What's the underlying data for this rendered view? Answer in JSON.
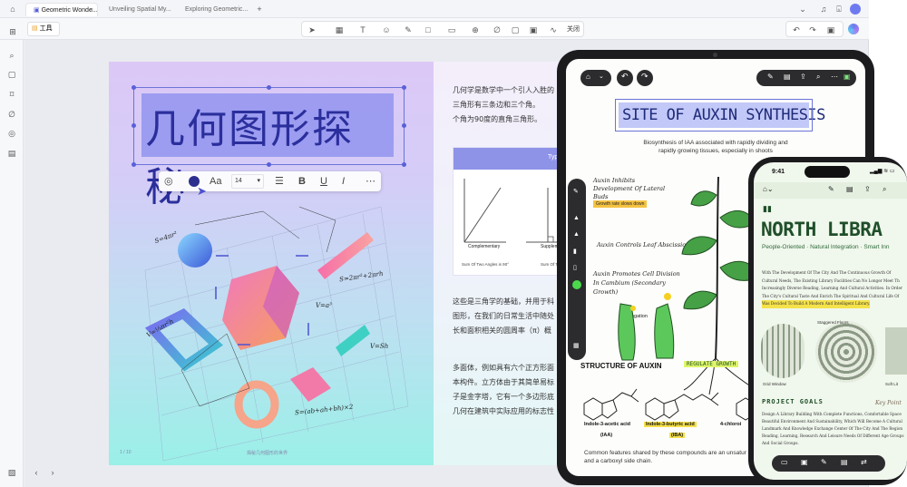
{
  "tabs": [
    "Geometric Wonde...",
    "Unveiling Spatial My...",
    "Exploring Geometric..."
  ],
  "toolbar": {
    "tools_label": "工具",
    "close_label": "关闭"
  },
  "page": {
    "title": "几何图形探秘",
    "font_size": "14",
    "font_label": "Aa",
    "para1": [
      "几何学是数学中一个引人入胜的",
      "三角形有三条边和三个角。",
      "个角为90度的直角三角形。"
    ],
    "para2": [
      "这些是三角学的基础，并用于科",
      "图形，在我们的日常生活中随处",
      "长和面积相关的圆周率（π）概"
    ],
    "para3": [
      "多面体，例如具有六个正方形面",
      "本构件。立方体由于其简单易标",
      "子是金字塔，它有一个多边形底",
      "几何在建筑中实际应用的标志性"
    ],
    "card_tab": "Typ",
    "card_labels": [
      "Complementary",
      "Supplem"
    ],
    "card_notes": [
      "Sum Of Two Angles is 90°",
      "Sum Of Two"
    ],
    "formulas": [
      "S=4πr²",
      "S=2πr²+2πrh",
      "V=a³",
      "V=Sh",
      "V=⅓πr²h",
      "S=(ab+ah+bh)×2"
    ],
    "footer_left": "1 / 10",
    "footer_center": "揭秘几何图形的世界"
  },
  "ipad": {
    "title": "SITE OF AUXIN SYNTHESIS",
    "subtitle": [
      "Biosynthesis of IAA associated with rapidly dividing and",
      "rapidly growing tissues, especially in shoots"
    ],
    "notes": [
      "Auxin Inhibits Development Of Lateral Buds",
      "Growth rate slows down",
      "Auxin Controls Leaf Abscission",
      "Auxin Promotes Cell Division In Cambium (Secondary Growth)",
      "Cell Elongation"
    ],
    "structure_title": "STRUCTURE OF AUXIN",
    "regulate_label": "REGULATE GROWTH",
    "compounds": [
      "Indole-3-acetic acid",
      "(IAA)",
      "Indole-3-butyric acid",
      "(IBA)",
      "4-chloroi"
    ],
    "footer": [
      "Common features shared by these compounds are an unsatur",
      "and a carboxyl side chain."
    ]
  },
  "phone": {
    "time": "9:41",
    "title": "NORTH LIBRA",
    "subtitle": "People-Oriented · Natural Integration · Smart Inn",
    "body": [
      "With The Development Of The City And The Continuous Growth Of",
      "Cultural Needs, The Existing Library Facilities Can No Longer Meet Th",
      "Increasingly Diverse Reading, Learning And Cultural Activities. In Order",
      "The City's Cultural Taste And Enrich The Spiritual And Cultural Life Of",
      "Was Decided To Build A Modern And Intelligent Library."
    ],
    "labels": [
      "Staggered Floors",
      "Grid Window",
      "Soft Lit"
    ],
    "goals_title": "PROJECT GOALS",
    "goals_note": "Key Point",
    "goals_body": [
      "Design A Library Building With Complete Functions, Comfortable Space",
      "Beautiful Environment And Sustainability, Which Will Become A Cultural",
      "Landmark And Knowledge Exchange Center Of The City And The Region",
      "Reading, Learning, Research And Leisure Needs Of Different Age Groups",
      "And Social Groups."
    ]
  },
  "colors": {
    "accent": "#5960d8",
    "title_bg": "#9294f0",
    "green": "#1f4f2a",
    "highlight": "#f5e04a"
  }
}
